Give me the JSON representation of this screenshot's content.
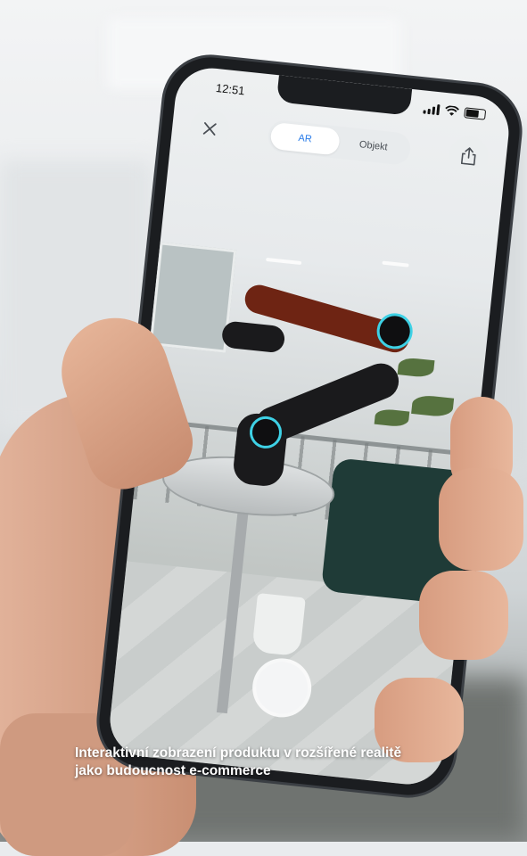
{
  "status_bar": {
    "time": "12:51"
  },
  "top_bar": {
    "close_icon": "close-icon",
    "share_icon": "share-icon",
    "segments": [
      {
        "label": "AR",
        "active": true
      },
      {
        "label": "Objekt",
        "active": false
      }
    ]
  },
  "colors": {
    "accent": "#2b7de9",
    "ring": "#3ed1e5"
  },
  "caption": {
    "line1": "Interaktivní zobrazení produktu v rozšířené realitě",
    "line2": "jako budoucnost e-commerce"
  }
}
